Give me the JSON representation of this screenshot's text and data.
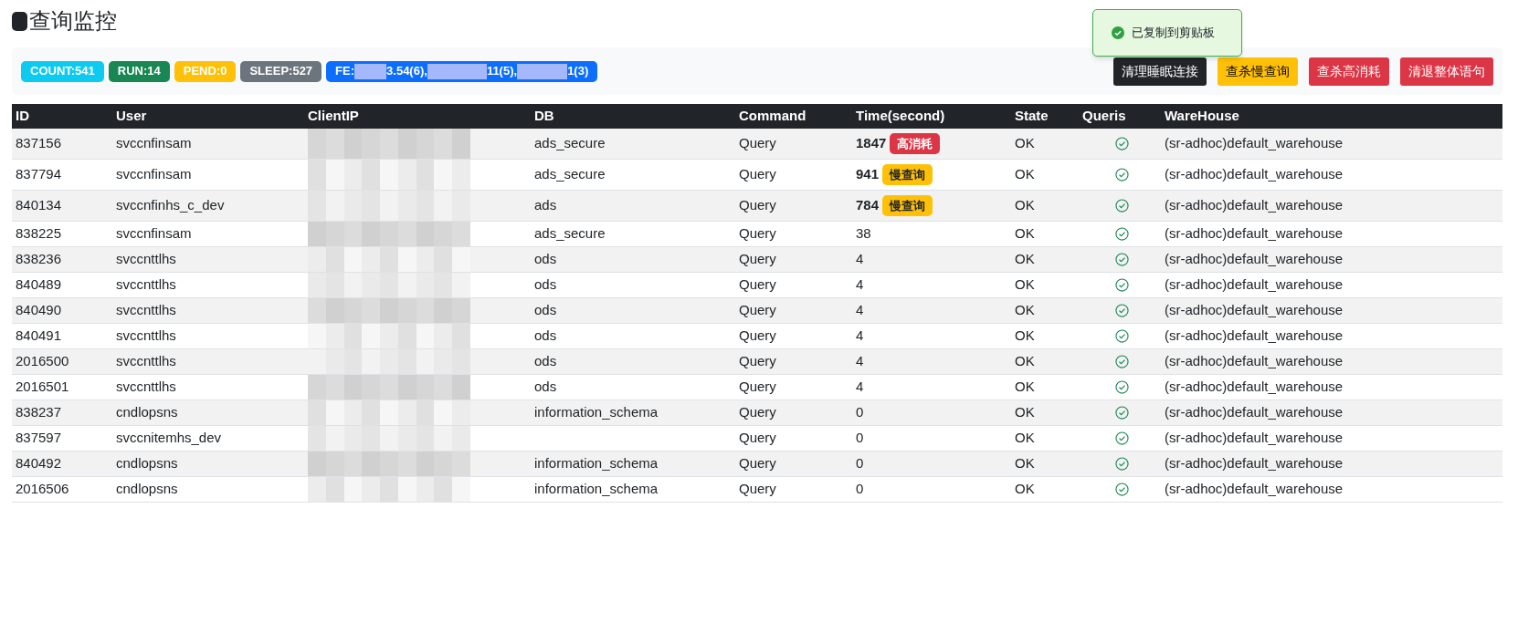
{
  "title": "查询监控",
  "badges": [
    {
      "text": "COUNT:541",
      "kind": "count"
    },
    {
      "text": "RUN:14",
      "kind": "run"
    },
    {
      "text": "PEND:0",
      "kind": "pend"
    },
    {
      "text": "SLEEP:527",
      "kind": "sleep"
    }
  ],
  "fe_badge": {
    "parts": [
      "FE:",
      "3.54(6),",
      "11(5),",
      "1(3)"
    ]
  },
  "buttons": [
    {
      "label": "清理睡眠连接",
      "kind": "dark"
    },
    {
      "label": "查杀慢查询",
      "kind": "warning"
    },
    {
      "label": "查杀高消耗",
      "kind": "danger"
    },
    {
      "label": "清退整体语句",
      "kind": "danger"
    }
  ],
  "toast": {
    "text": "已复制到剪贴板"
  },
  "table": {
    "columns": [
      "ID",
      "User",
      "ClientIP",
      "DB",
      "Command",
      "Time(second)",
      "State",
      "Queris",
      "WareHouse"
    ],
    "rows": [
      {
        "id": "837156",
        "user": "svccnfinsam",
        "db": "ads_secure",
        "command": "Query",
        "time": "1847",
        "tag": {
          "text": "高消耗",
          "kind": "high"
        },
        "state": "OK",
        "queris": true,
        "warehouse": "(sr-adhoc)default_warehouse"
      },
      {
        "id": "837794",
        "user": "svccnfinsam",
        "db": "ads_secure",
        "command": "Query",
        "time": "941",
        "tag": {
          "text": "慢查询",
          "kind": "slow"
        },
        "state": "OK",
        "queris": true,
        "warehouse": "(sr-adhoc)default_warehouse"
      },
      {
        "id": "840134",
        "user": "svccnfinhs_c_dev",
        "db": "ads",
        "command": "Query",
        "time": "784",
        "tag": {
          "text": "慢查询",
          "kind": "slow"
        },
        "state": "OK",
        "queris": true,
        "warehouse": "(sr-adhoc)default_warehouse"
      },
      {
        "id": "838225",
        "user": "svccnfinsam",
        "db": "ads_secure",
        "command": "Query",
        "time": "38",
        "state": "OK",
        "queris": true,
        "warehouse": "(sr-adhoc)default_warehouse"
      },
      {
        "id": "838236",
        "user": "svccnttlhs",
        "db": "ods",
        "command": "Query",
        "time": "4",
        "state": "OK",
        "queris": true,
        "warehouse": "(sr-adhoc)default_warehouse"
      },
      {
        "id": "840489",
        "user": "svccnttlhs",
        "db": "ods",
        "command": "Query",
        "time": "4",
        "state": "OK",
        "queris": true,
        "warehouse": "(sr-adhoc)default_warehouse"
      },
      {
        "id": "840490",
        "user": "svccnttlhs",
        "db": "ods",
        "command": "Query",
        "time": "4",
        "state": "OK",
        "queris": true,
        "warehouse": "(sr-adhoc)default_warehouse"
      },
      {
        "id": "840491",
        "user": "svccnttlhs",
        "db": "ods",
        "command": "Query",
        "time": "4",
        "state": "OK",
        "queris": true,
        "warehouse": "(sr-adhoc)default_warehouse"
      },
      {
        "id": "2016500",
        "user": "svccnttlhs",
        "db": "ods",
        "command": "Query",
        "time": "4",
        "state": "OK",
        "queris": true,
        "warehouse": "(sr-adhoc)default_warehouse"
      },
      {
        "id": "2016501",
        "user": "svccnttlhs",
        "db": "ods",
        "command": "Query",
        "time": "4",
        "state": "OK",
        "queris": true,
        "warehouse": "(sr-adhoc)default_warehouse"
      },
      {
        "id": "838237",
        "user": "cndlopsns",
        "db": "information_schema",
        "command": "Query",
        "time": "0",
        "state": "OK",
        "queris": true,
        "warehouse": "(sr-adhoc)default_warehouse"
      },
      {
        "id": "837597",
        "user": "svccnitemhs_dev",
        "command": "Query",
        "time": "0",
        "state": "OK",
        "queris": true,
        "warehouse": "(sr-adhoc)default_warehouse"
      },
      {
        "id": "840492",
        "user": "cndlopsns",
        "db": "information_schema",
        "command": "Query",
        "time": "0",
        "state": "OK",
        "queris": true,
        "warehouse": "(sr-adhoc)default_warehouse"
      },
      {
        "id": "2016506",
        "user": "cndlopsns",
        "db": "information_schema",
        "command": "Query",
        "time": "0",
        "state": "OK",
        "queris": true,
        "warehouse": "(sr-adhoc)default_warehouse"
      }
    ]
  }
}
